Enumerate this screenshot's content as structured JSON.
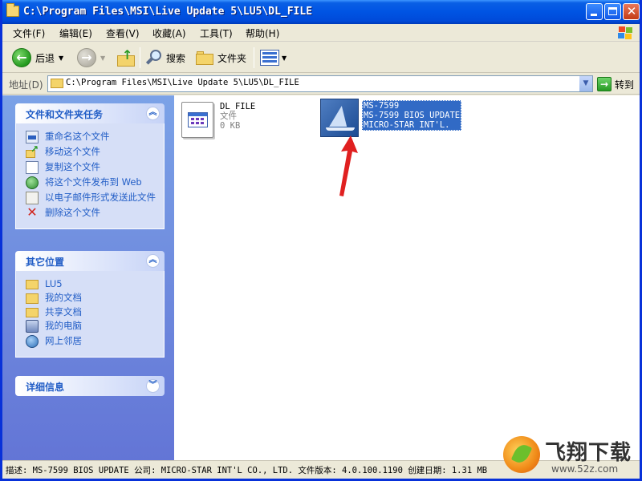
{
  "window": {
    "title": "C:\\Program Files\\MSI\\Live Update 5\\LU5\\DL_FILE"
  },
  "menu": [
    "文件(F)",
    "编辑(E)",
    "查看(V)",
    "收藏(A)",
    "工具(T)",
    "帮助(H)"
  ],
  "toolbar": {
    "back_label": "后退",
    "search_label": "搜索",
    "folders_label": "文件夹"
  },
  "address": {
    "label": "地址(D)",
    "value": "C:\\Program Files\\MSI\\Live Update 5\\LU5\\DL_FILE",
    "go_label": "转到"
  },
  "task_pane": {
    "file_tasks": {
      "title": "文件和文件夹任务",
      "items": [
        "重命名这个文件",
        "移动这个文件",
        "复制这个文件",
        "将这个文件发布到 Web",
        "以电子邮件形式发送此文件",
        "删除这个文件"
      ]
    },
    "other_places": {
      "title": "其它位置",
      "items": [
        "LU5",
        "我的文档",
        "共享文档",
        "我的电脑",
        "网上邻居"
      ]
    },
    "details": {
      "title": "详细信息"
    }
  },
  "files": [
    {
      "name": "DL_FILE",
      "type": "文件",
      "size": "0 KB",
      "icon": "generic-file-icon"
    },
    {
      "name": "MS-7599",
      "description": "MS-7599 BIOS UPDATE",
      "company": "MICRO-STAR INT'L.",
      "icon": "msi-sailboat-icon",
      "selected": true
    }
  ],
  "status": {
    "text": "描述: MS-7599 BIOS UPDATE 公司: MICRO-STAR INT'L CO., LTD. 文件版本: 4.0.100.1190 创建日期: 1.31 MB"
  },
  "watermark": {
    "name": "飞翔下载",
    "url": "www.52z.com"
  },
  "colors": {
    "titlebar": "#0054e3",
    "task_pane": "#7ba2e7",
    "selection": "#316ac5",
    "annotation_arrow": "#e02020"
  }
}
